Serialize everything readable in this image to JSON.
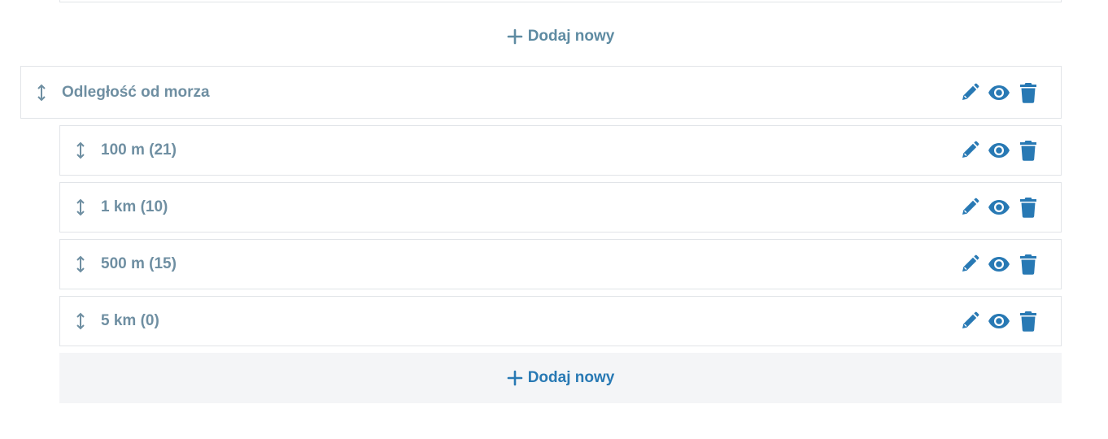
{
  "add_new_label": "Dodaj nowy",
  "parent": {
    "label": "Odległość od morza",
    "icons": [
      "drag-vertical-icon",
      "pencil-icon",
      "eye-icon",
      "trash-icon"
    ]
  },
  "children": [
    {
      "label": "100 m (21)"
    },
    {
      "label": "1 km (10)"
    },
    {
      "label": "500 m (15)"
    },
    {
      "label": "5 km (0)"
    }
  ],
  "colors": {
    "accent": "#2879b4",
    "muted_text": "#6f8fa2",
    "add_top": "#5e8ba2",
    "border": "#e1e4e8",
    "add_bottom_bg": "#f4f5f7"
  }
}
